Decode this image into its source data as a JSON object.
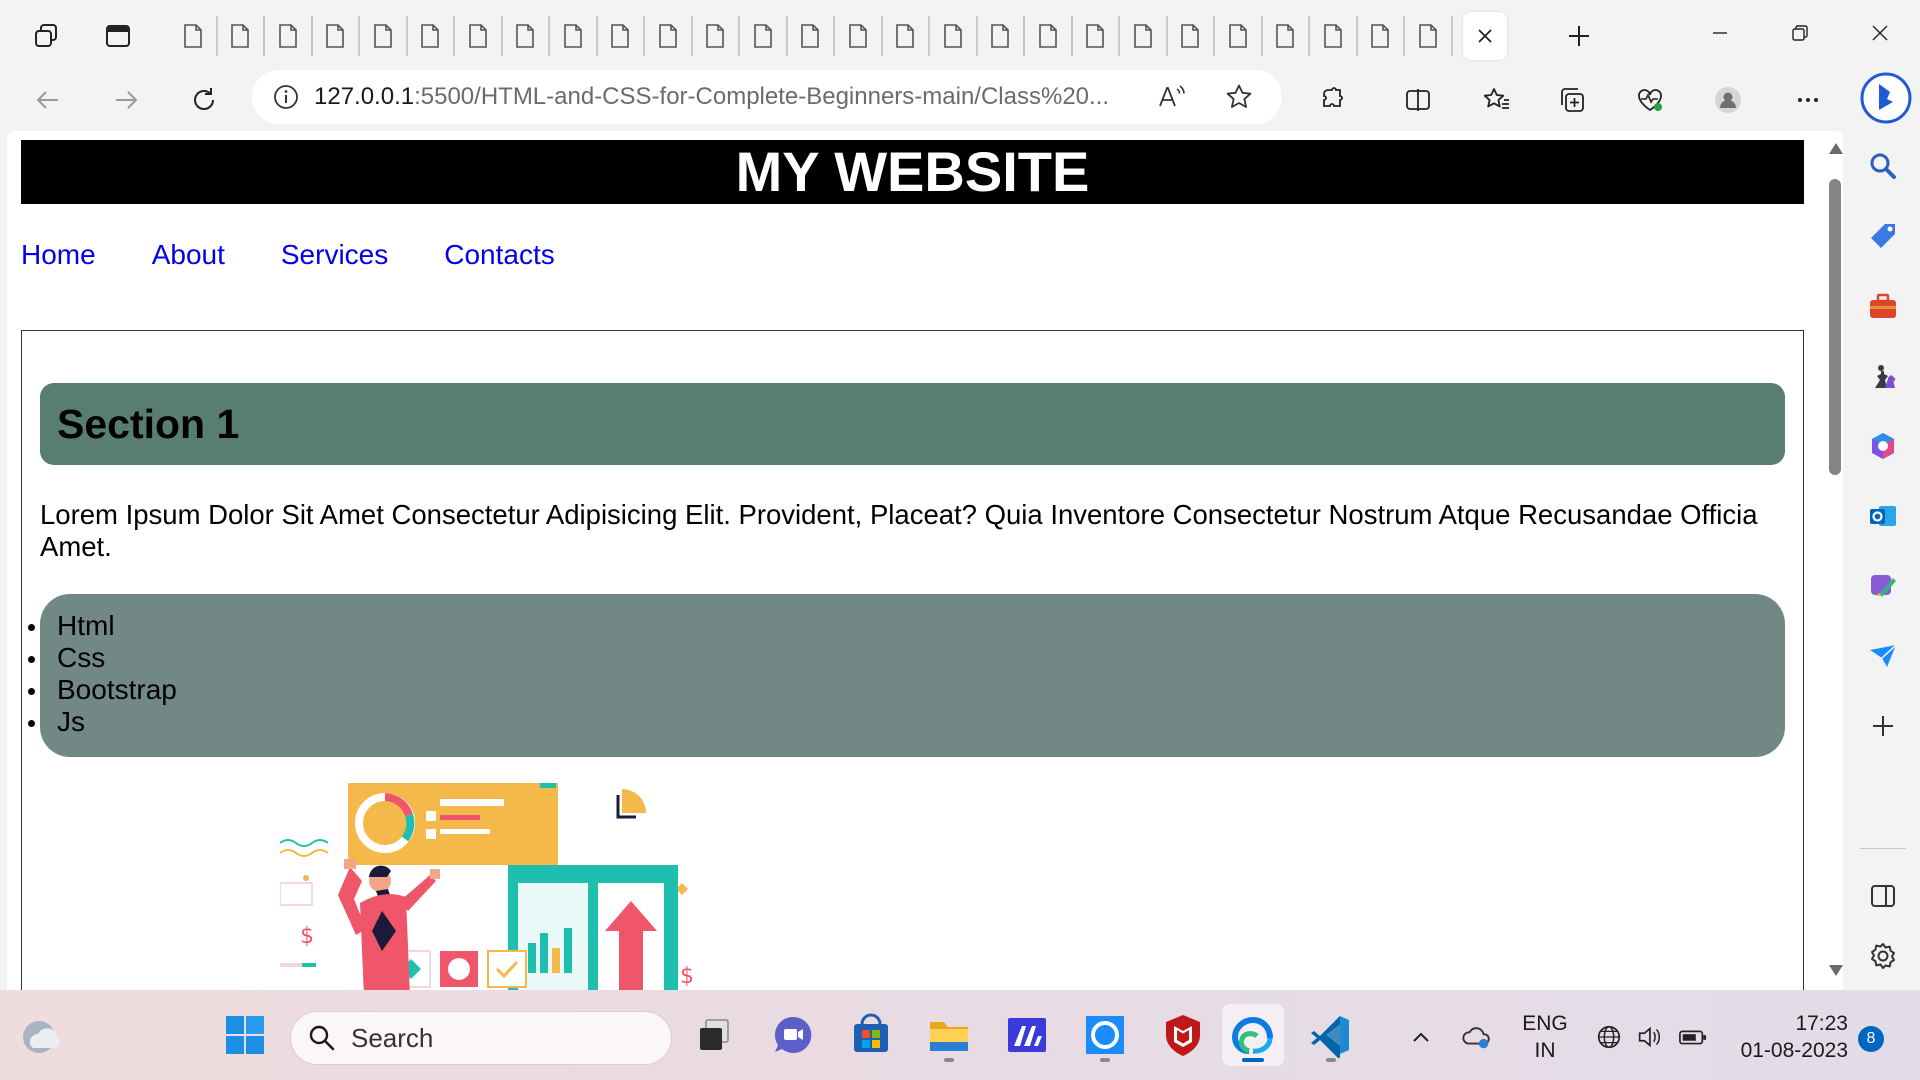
{
  "browser": {
    "tab_count_visible": 27,
    "address": {
      "host": "127.0.0.1",
      "rest": ":5500/HTML-and-CSS-for-Complete-Beginners-main/Class%20..."
    }
  },
  "page": {
    "header_title": "MY WEBSITE",
    "nav": [
      "Home",
      "About",
      "Services",
      "Contacts"
    ],
    "section": {
      "title": "Section 1",
      "paragraph": "Lorem Ipsum Dolor Sit Amet Consectetur Adipisicing Elit. Provident, Placeat? Quia Inventore Consectetur Nostrum Atque Recusandae Officia Amet.",
      "list": [
        "Html",
        "Css",
        "Bootstrap",
        "Js"
      ]
    },
    "colors": {
      "header_bg": "#000000",
      "title_bg": "#587e70",
      "list_bg": "#728884",
      "link": "#0000ee"
    }
  },
  "taskbar": {
    "search_label": "Search",
    "lang_top": "ENG",
    "lang_bottom": "IN",
    "time": "17:23",
    "date": "01-08-2023",
    "notifications": "8"
  }
}
